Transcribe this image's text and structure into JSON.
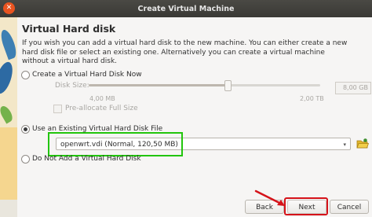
{
  "window": {
    "title": "Create Virtual Machine",
    "close_symbol": "✕"
  },
  "page": {
    "heading": "Virtual Hard disk",
    "description": "If you wish you can add a virtual hard disk to the new machine. You can either create a new hard disk file or select an existing one. Alternatively you can create a virtual machine without a virtual hard disk."
  },
  "options": {
    "create_new": {
      "label": "Create a Virtual Hard Disk Now",
      "selected": false
    },
    "disk_size": {
      "label": "Disk Size:",
      "min_label": "4,00 MB",
      "max_label": "2,00 TB",
      "value": "8,00 GB",
      "enabled": false
    },
    "preallocate": {
      "label": "Pre-allocate Full Size",
      "checked": false,
      "enabled": false
    },
    "use_existing": {
      "label": "Use an Existing Virtual Hard Disk File",
      "selected": true
    },
    "existing_file": {
      "value": "openwrt.vdi (Normal, 120,50 MB)"
    },
    "no_disk": {
      "label": "Do Not Add a Virtual Hard Disk",
      "selected": false
    }
  },
  "buttons": {
    "back": "Back",
    "next": "Next",
    "cancel": "Cancel"
  },
  "icons": {
    "combo_arrow": "▾",
    "folder": "folder-open-icon"
  },
  "colors": {
    "highlight_green": "#22c50c",
    "annotation_red": "#d5131a",
    "titlebar": "#3d3c38",
    "close_button": "#e95420"
  }
}
